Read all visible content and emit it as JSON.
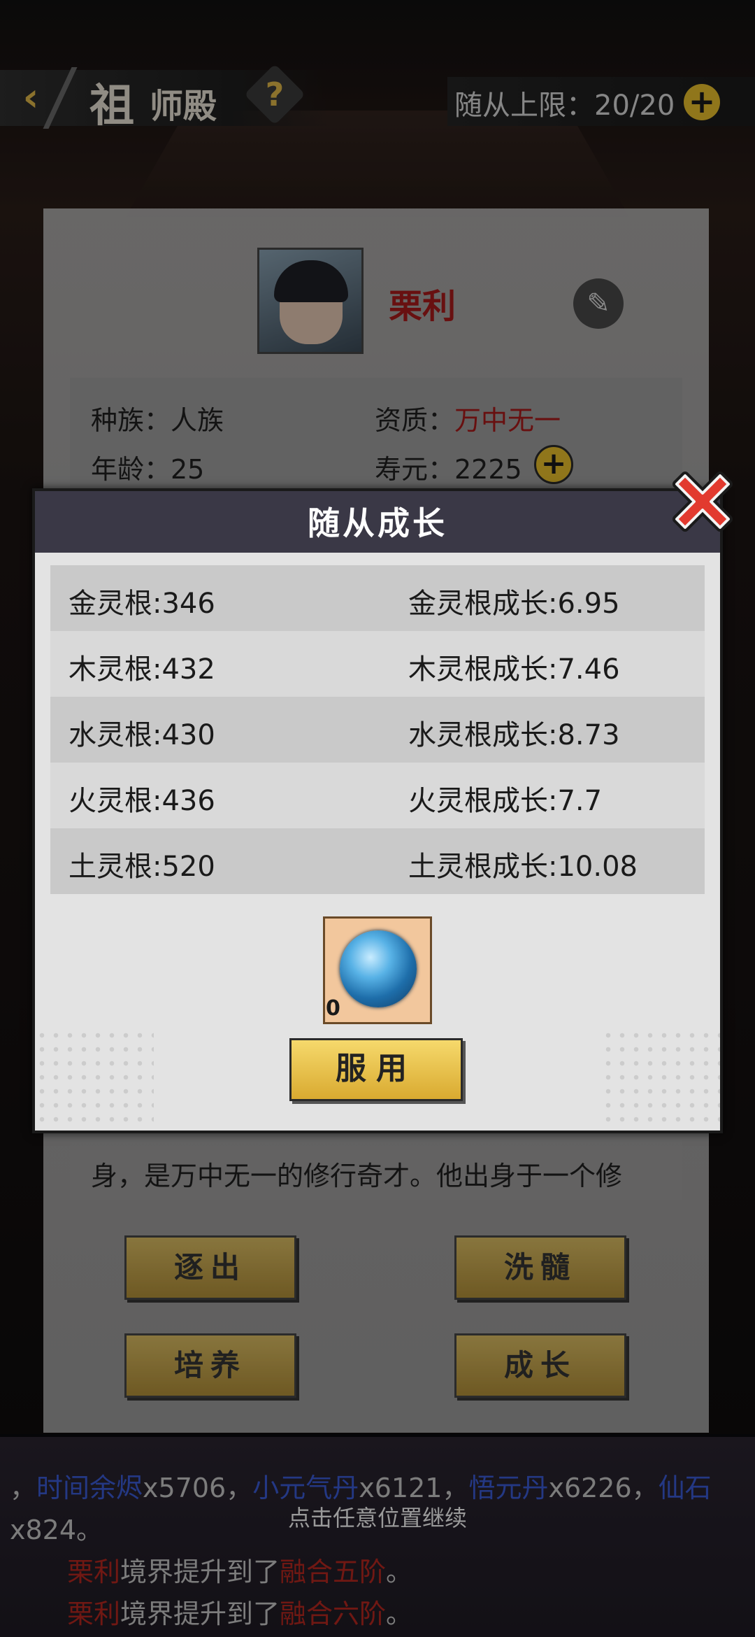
{
  "header": {
    "back_icon": "chevron-left-icon",
    "title_char": "祖",
    "title_rest": "师殿",
    "help_label": "?",
    "capacity_label": "随从上限：20/20",
    "capacity_plus": "+"
  },
  "character": {
    "name": "栗利",
    "edit_icon": "✎",
    "race_label": "种族：人族",
    "aptitude_label": "资质：",
    "aptitude_value": "万中无一",
    "age_label": "年龄：25",
    "lifespan_label": "寿元：2225",
    "lifespan_plus": "+",
    "description": "身，是万中无一的修行奇才。他出身于一个修"
  },
  "actions": {
    "expel": "逐出",
    "cleanse": "洗髓",
    "cultivate": "培养",
    "growth": "成长"
  },
  "modal": {
    "title": "随从成长",
    "stats": [
      {
        "left": "金灵根:346",
        "right": "金灵根成长:6.95"
      },
      {
        "left": "木灵根:432",
        "right": "木灵根成长:7.46"
      },
      {
        "left": "水灵根:430",
        "right": "水灵根成长:8.73"
      },
      {
        "left": "火灵根:436",
        "right": "火灵根成长:7.7"
      },
      {
        "left": "土灵根:520",
        "right": "土灵根成长:10.08"
      }
    ],
    "item_count": "0",
    "use_button": "服用"
  },
  "log": {
    "line1_a": "，",
    "line1_b": "时间余烬",
    "line1_c": "x5706，",
    "line1_d": "小元气丹",
    "line1_e": "x6121，",
    "line1_f": "悟元丹",
    "line1_g": "x6226，",
    "line1_h": "仙石",
    "line2": "x824。",
    "line3_name": "栗利",
    "line3_mid": "境界提升到了",
    "line3_realm": "融合五阶",
    "line3_end": "。",
    "line4_name": "栗利",
    "line4_mid": "境界提升到了",
    "line4_realm": "融合六阶",
    "line4_end": "。",
    "continue_hint": "点击任意位置继续"
  },
  "colors": {
    "accent_gold": "#e8bf2c",
    "name_red": "#a81a1a",
    "item_blue": "#3a5bd6",
    "modal_header": "#3a3846"
  }
}
